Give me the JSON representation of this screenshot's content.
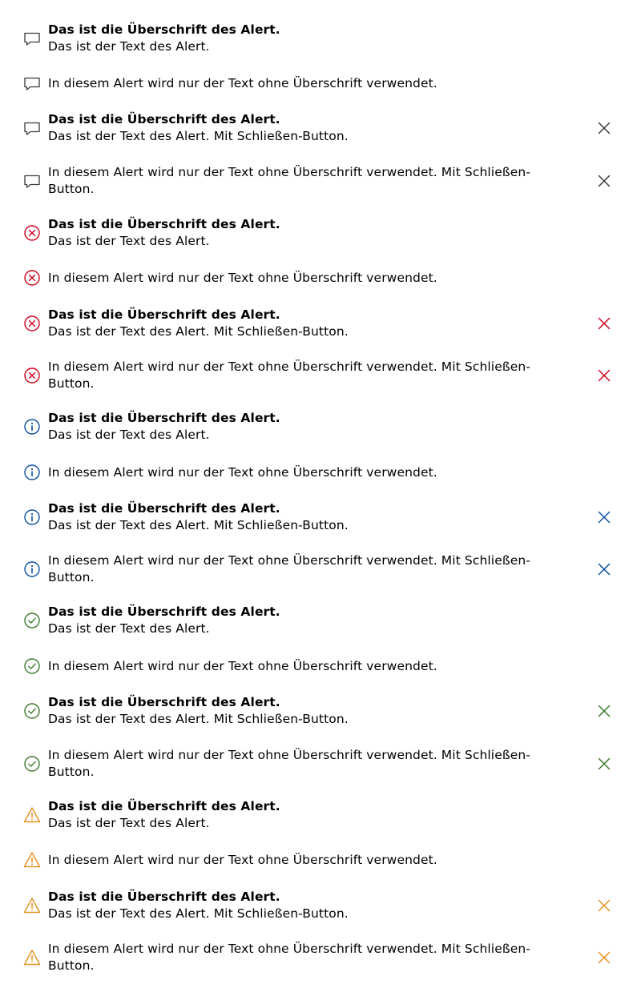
{
  "colors": {
    "neutral": "#3a3a3a",
    "error": "#d0021b",
    "info": "#0a4f9e",
    "success": "#3d7a2c",
    "warning": "#e8901c"
  },
  "alerts": [
    {
      "variant": "neutral",
      "icon": "chat-bubble-icon",
      "title": "Das ist die Überschrift des Alert.",
      "text": "Das ist der Text des Alert.",
      "closable": false
    },
    {
      "variant": "neutral",
      "icon": "chat-bubble-icon",
      "title": "",
      "text": "In diesem Alert wird nur der Text ohne Überschrift verwendet.",
      "closable": false
    },
    {
      "variant": "neutral",
      "icon": "chat-bubble-icon",
      "title": "Das ist die Überschrift des Alert.",
      "text": "Das ist der Text des Alert. Mit Schließen-Button.",
      "closable": true
    },
    {
      "variant": "neutral",
      "icon": "chat-bubble-icon",
      "title": "",
      "text": "In diesem Alert wird nur der Text ohne Überschrift verwendet. Mit Schließen-Button.",
      "closable": true
    },
    {
      "variant": "error",
      "icon": "error-circle-icon",
      "title": "Das ist die Überschrift des Alert.",
      "text": "Das ist der Text des Alert.",
      "closable": false
    },
    {
      "variant": "error",
      "icon": "error-circle-icon",
      "title": "",
      "text": "In diesem Alert wird nur der Text ohne Überschrift verwendet.",
      "closable": false
    },
    {
      "variant": "error",
      "icon": "error-circle-icon",
      "title": "Das ist die Überschrift des Alert.",
      "text": "Das ist der Text des Alert. Mit Schließen-Button.",
      "closable": true
    },
    {
      "variant": "error",
      "icon": "error-circle-icon",
      "title": "",
      "text": "In diesem Alert wird nur der Text ohne Überschrift verwendet. Mit Schließen-Button.",
      "closable": true
    },
    {
      "variant": "info",
      "icon": "info-circle-icon",
      "title": "Das ist die Überschrift des Alert.",
      "text": "Das ist der Text des Alert.",
      "closable": false
    },
    {
      "variant": "info",
      "icon": "info-circle-icon",
      "title": "",
      "text": "In diesem Alert wird nur der Text ohne Überschrift verwendet.",
      "closable": false
    },
    {
      "variant": "info",
      "icon": "info-circle-icon",
      "title": "Das ist die Überschrift des Alert.",
      "text": "Das ist der Text des Alert. Mit Schließen-Button.",
      "closable": true
    },
    {
      "variant": "info",
      "icon": "info-circle-icon",
      "title": "",
      "text": "In diesem Alert wird nur der Text ohne Überschrift verwendet. Mit Schließen-Button.",
      "closable": true
    },
    {
      "variant": "success",
      "icon": "check-circle-icon",
      "title": "Das ist die Überschrift des Alert.",
      "text": "Das ist der Text des Alert.",
      "closable": false
    },
    {
      "variant": "success",
      "icon": "check-circle-icon",
      "title": "",
      "text": "In diesem Alert wird nur der Text ohne Überschrift verwendet.",
      "closable": false
    },
    {
      "variant": "success",
      "icon": "check-circle-icon",
      "title": "Das ist die Überschrift des Alert.",
      "text": "Das ist der Text des Alert. Mit Schließen-Button.",
      "closable": true
    },
    {
      "variant": "success",
      "icon": "check-circle-icon",
      "title": "",
      "text": "In diesem Alert wird nur der Text ohne Überschrift verwendet. Mit Schließen-Button.",
      "closable": true
    },
    {
      "variant": "warning",
      "icon": "warning-triangle-icon",
      "title": "Das ist die Überschrift des Alert.",
      "text": "Das ist der Text des Alert.",
      "closable": false
    },
    {
      "variant": "warning",
      "icon": "warning-triangle-icon",
      "title": "",
      "text": "In diesem Alert wird nur der Text ohne Überschrift verwendet.",
      "closable": false
    },
    {
      "variant": "warning",
      "icon": "warning-triangle-icon",
      "title": "Das ist die Überschrift des Alert.",
      "text": "Das ist der Text des Alert. Mit Schließen-Button.",
      "closable": true
    },
    {
      "variant": "warning",
      "icon": "warning-triangle-icon",
      "title": "",
      "text": "In diesem Alert wird nur der Text ohne Überschrift verwendet. Mit Schließen-Button.",
      "closable": true
    }
  ]
}
